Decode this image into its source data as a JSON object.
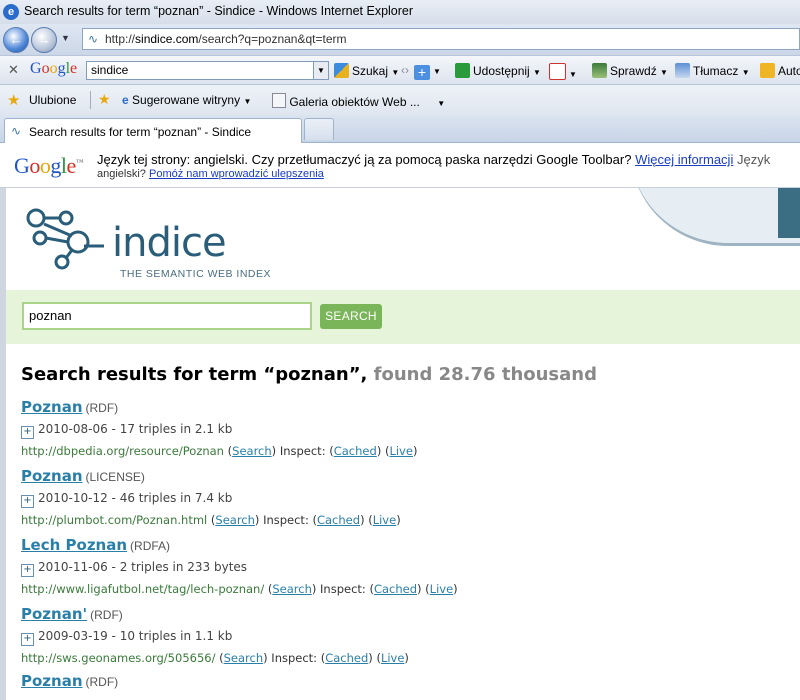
{
  "window": {
    "title": "Search results for term “poznan” - Sindice - Windows Internet Explorer"
  },
  "address": {
    "url_prefix": "http://",
    "url_host": "sindice.com",
    "url_path": "/search?q=poznan&qt=term"
  },
  "google_toolbar": {
    "logo": "Google",
    "search_value": "sindice",
    "szukaj": "Szukaj",
    "udostepnij": "Udostępnij",
    "sprawdz": "Sprawdź",
    "tlumacz": "Tłumacz",
    "auto": "Auto"
  },
  "favorites": {
    "ulubione": "Ulubione",
    "sugerowane": "Sugerowane witryny",
    "galeria": "Galeria obiektów Web ..."
  },
  "tab": {
    "label": "Search results for term “poznan” - Sindice"
  },
  "translate": {
    "message": "Język tej strony: angielski. Czy przetłumaczyć ją za pomocą paska narzędzi Google Toolbar?",
    "more_info": "Więcej informacji",
    "trailing": "Język",
    "line2_prefix": "angielski?",
    "help_link": "Pomóż nam wprowadzić ulepszenia"
  },
  "sindice": {
    "logo_text": "indice",
    "logo_sub": "THE SEMANTIC WEB INDEX",
    "search_value": "poznan",
    "search_button": "SEARCH",
    "results_title": "Search results for term “poznan”,",
    "results_found": "found 28.76 thousand"
  },
  "results": [
    {
      "name": "Poznan",
      "type": "(RDF)",
      "meta": "2010-08-06 - 17 triples in 2.1 kb",
      "url": "http://dbpedia.org/resource/Poznan"
    },
    {
      "name": "Poznan",
      "type": "(LICENSE)",
      "meta": "2010-10-12 - 46 triples in 7.4 kb",
      "url": "http://plumbot.com/Poznan.html"
    },
    {
      "name": "Lech Poznan",
      "type": "(RDFA)",
      "meta": "2010-11-06 - 2 triples in 233 bytes",
      "url": "http://www.ligafutbol.net/tag/lech-poznan/"
    },
    {
      "name": "Poznan'",
      "type": "(RDF)",
      "meta": "2009-03-19 - 10 triples in 1.1 kb",
      "url": "http://sws.geonames.org/505656/"
    },
    {
      "name": "Poznan",
      "type": "(RDF)",
      "meta": "",
      "url": ""
    }
  ],
  "result_links": {
    "search": "Search",
    "inspect": "Inspect:",
    "cached": "Cached",
    "live": "Live"
  },
  "colors": {
    "sindice_blue": "#2a5d79",
    "link_blue": "#2a7fa8",
    "search_green": "#7bb55a",
    "band_green": "#e6f5da"
  },
  "icons": [
    "back-arrow-icon",
    "forward-arrow-icon",
    "favorites-star-icon",
    "ie-page-icon",
    "sindice-logo-icon",
    "expand-plus-icon"
  ]
}
